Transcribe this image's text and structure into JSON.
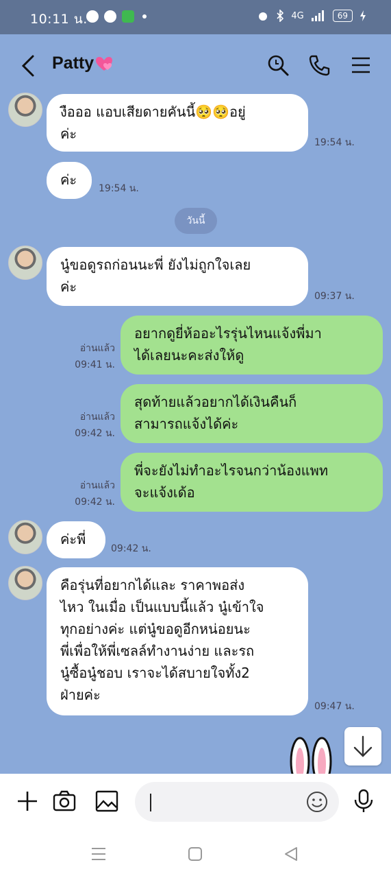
{
  "status": {
    "time": "10:11 น.",
    "battery": "69",
    "network": "4G"
  },
  "header": {
    "title": "Patty",
    "title_emoji": "heart"
  },
  "date_divider": "วันนี้",
  "messages": [
    {
      "dir": "in",
      "text_lines": [
        "งือออ แอบเสียดายคันนี้🥺🥺อยู่",
        "ค่ะ"
      ],
      "time": "19:54 น."
    },
    {
      "dir": "in",
      "text_lines": [
        "ค่ะ"
      ],
      "time": "19:54 น."
    },
    {
      "dir": "in",
      "text_lines": [
        "นู๋ขอดูรถก่อนนะพี่ ยังไม่ถูกใจเลย",
        "ค่ะ"
      ],
      "time": "09:37 น."
    },
    {
      "dir": "out",
      "text_lines": [
        "อยากดูยี่ห้ออะไรรุ่นไหนแจ้งพี่มา",
        "ได้เลยนะคะส่งให้ดู"
      ],
      "read": "อ่านแล้ว",
      "time": "09:41 น."
    },
    {
      "dir": "out",
      "text_lines": [
        "สุดท้ายแล้วอยากได้เงินคืนก็",
        "สามารถแจ้งได้ค่ะ"
      ],
      "read": "อ่านแล้ว",
      "time": "09:42 น."
    },
    {
      "dir": "out",
      "text_lines": [
        "พี่จะยังไม่ทำอะไรจนกว่าน้องแพท",
        "จะแจ้งเด้อ"
      ],
      "read": "อ่านแล้ว",
      "time": "09:42 น."
    },
    {
      "dir": "in",
      "text_lines": [
        "ค่ะพี่"
      ],
      "time": "09:42 น."
    },
    {
      "dir": "in",
      "text_lines": [
        "คือรุ่นที่อยากได้และ ราคาพอส่ง",
        "ไหว ในเมื่อ เป็นแบบนี้แล้ว นู๋เข้าใจ",
        "ทุกอย่างค่ะ แต่นู๋ขอดูอีกหน่อยนะ",
        "พี่เพื่อให้พี่เซลล์ทำงานง่าย และรถ",
        "นู๋ซื้อนู๋ชอบ เราจะได้สบายใจทั้ง2",
        "ฝ่ายค่ะ"
      ],
      "time": "09:47 น."
    }
  ],
  "colors": {
    "chat_bg": "#8aa9d9",
    "out_bubble": "#a3e18f",
    "in_bubble": "#ffffff",
    "statusbar": "#5f7394"
  },
  "icons": [
    "back-icon",
    "search-icon",
    "phone-icon",
    "menu-icon",
    "plus-icon",
    "camera-icon",
    "image-icon",
    "emoji-icon",
    "mic-icon",
    "scroll-down-icon"
  ]
}
